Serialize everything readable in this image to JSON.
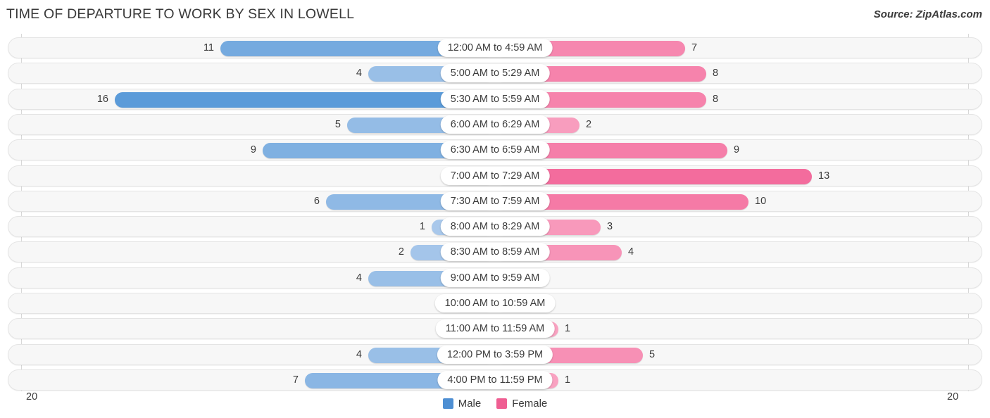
{
  "header": {
    "title": "TIME OF DEPARTURE TO WORK BY SEX IN LOWELL",
    "source": "Source: ZipAtlas.com"
  },
  "axis": {
    "left_label": "20",
    "right_label": "20"
  },
  "legend": {
    "items": [
      {
        "label": "Male",
        "color": "#4e8fd3"
      },
      {
        "label": "Female",
        "color": "#ef5e92"
      }
    ]
  },
  "colors": {
    "male_dark": "#5b9bd9",
    "male_light": "#aecbec",
    "female_dark": "#f25f94",
    "female_light": "#f9a6c4",
    "row_bg": "#f7f7f7",
    "row_border": "#e4e4e4",
    "gridline": "#d8d8d8",
    "text": "#3b3b3b"
  },
  "chart_data": {
    "type": "bar",
    "title": "TIME OF DEPARTURE TO WORK BY SEX IN LOWELL",
    "subtitle": "",
    "xlabel": "",
    "ylabel": "",
    "orientation": "horizontal-diverging",
    "grid": true,
    "legend_position": "bottom-center",
    "axis_max": 20,
    "xlim": [
      20,
      20
    ],
    "categories": [
      "12:00 AM to 4:59 AM",
      "5:00 AM to 5:29 AM",
      "5:30 AM to 5:59 AM",
      "6:00 AM to 6:29 AM",
      "6:30 AM to 6:59 AM",
      "7:00 AM to 7:29 AM",
      "7:30 AM to 7:59 AM",
      "8:00 AM to 8:29 AM",
      "8:30 AM to 8:59 AM",
      "9:00 AM to 9:59 AM",
      "10:00 AM to 10:59 AM",
      "11:00 AM to 11:59 AM",
      "12:00 PM to 3:59 PM",
      "4:00 PM to 11:59 PM"
    ],
    "series": [
      {
        "name": "Male",
        "values": [
          11,
          4,
          16,
          5,
          9,
          0,
          6,
          1,
          2,
          4,
          0,
          0,
          4,
          7
        ]
      },
      {
        "name": "Female",
        "values": [
          7,
          8,
          8,
          2,
          9,
          13,
          10,
          3,
          4,
          0,
          0,
          1,
          5,
          1
        ]
      }
    ]
  }
}
